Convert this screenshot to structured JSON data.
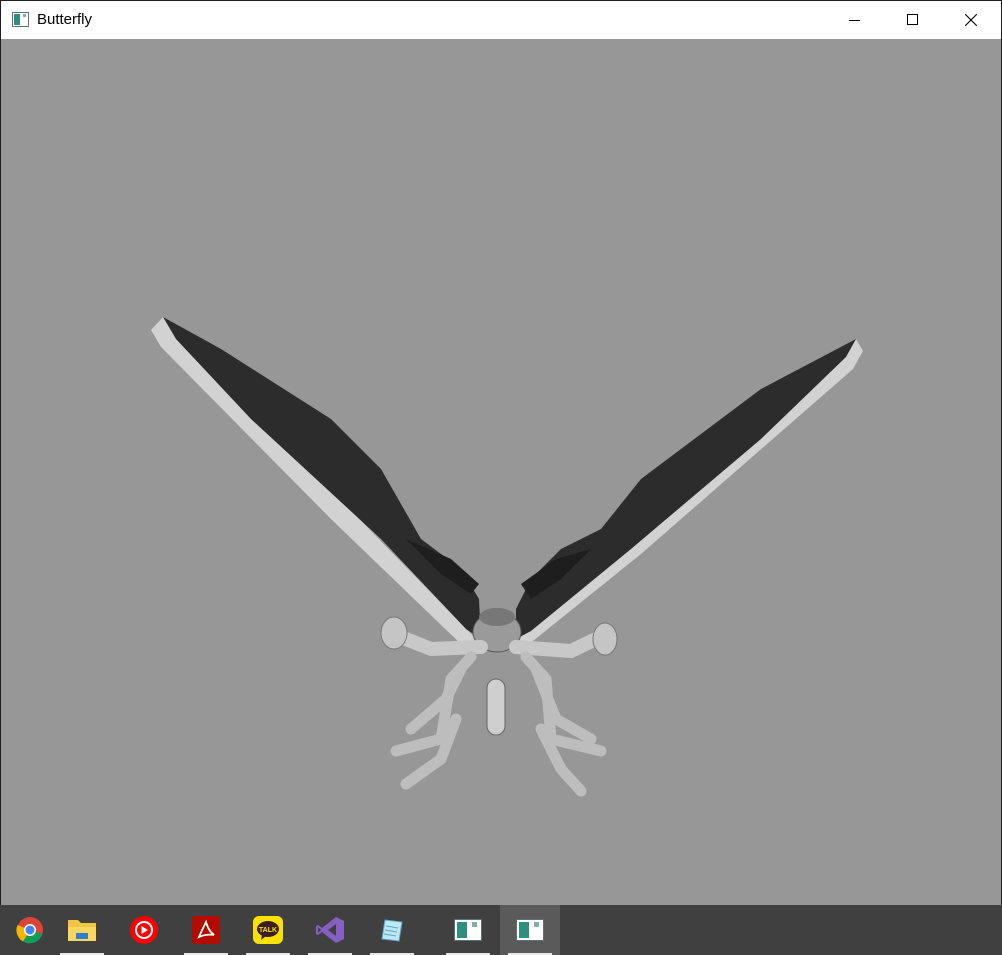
{
  "window": {
    "title": "Butterfly",
    "controls": [
      "minimize",
      "maximize",
      "close"
    ]
  },
  "viewport": {
    "background": "#979797",
    "scene": "3d-butterfly-model"
  },
  "taskbar": {
    "background": "#404040",
    "items": [
      {
        "name": "chrome-icon",
        "running": false
      },
      {
        "name": "file-explorer-icon",
        "running": true
      },
      {
        "name": "youtube-music-icon",
        "running": false
      },
      {
        "name": "acrobat-reader-icon",
        "running": true
      },
      {
        "name": "kakaotalk-icon",
        "running": true,
        "label": "TALK"
      },
      {
        "name": "visual-studio-icon",
        "running": true
      },
      {
        "name": "notepad-icon",
        "running": true
      },
      {
        "name": "app-window-icon",
        "running": true
      },
      {
        "name": "app-window-icon",
        "running": true,
        "active": true
      }
    ]
  }
}
